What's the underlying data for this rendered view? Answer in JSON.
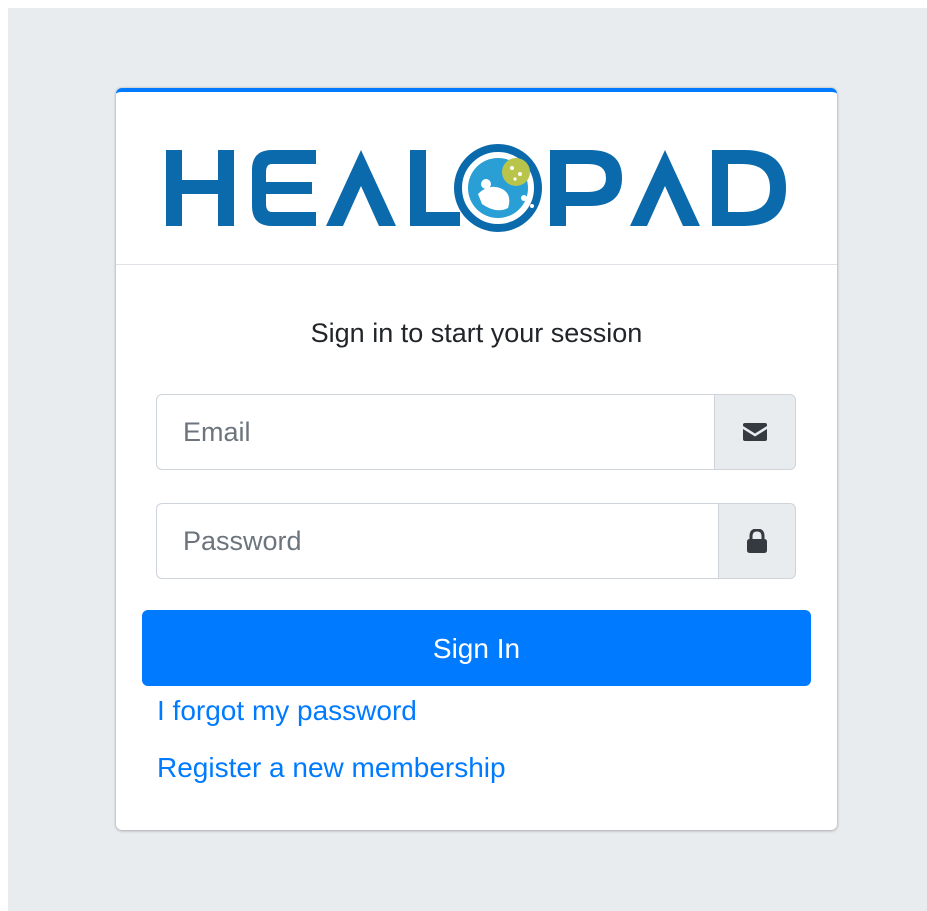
{
  "login": {
    "message": "Sign in to start your session",
    "email_placeholder": "Email",
    "password_placeholder": "Password",
    "signin_label": "Sign In",
    "forgot_label": "I forgot my password",
    "register_label": "Register a new membership"
  },
  "logo": {
    "text": "HEALOPAD",
    "brand_color": "#0a6aab",
    "accent_color": "#2a9fd6"
  },
  "icons": {
    "email": "envelope-icon",
    "password": "lock-icon"
  },
  "colors": {
    "primary": "#007bff",
    "background": "#e9ecef",
    "card": "#ffffff"
  }
}
